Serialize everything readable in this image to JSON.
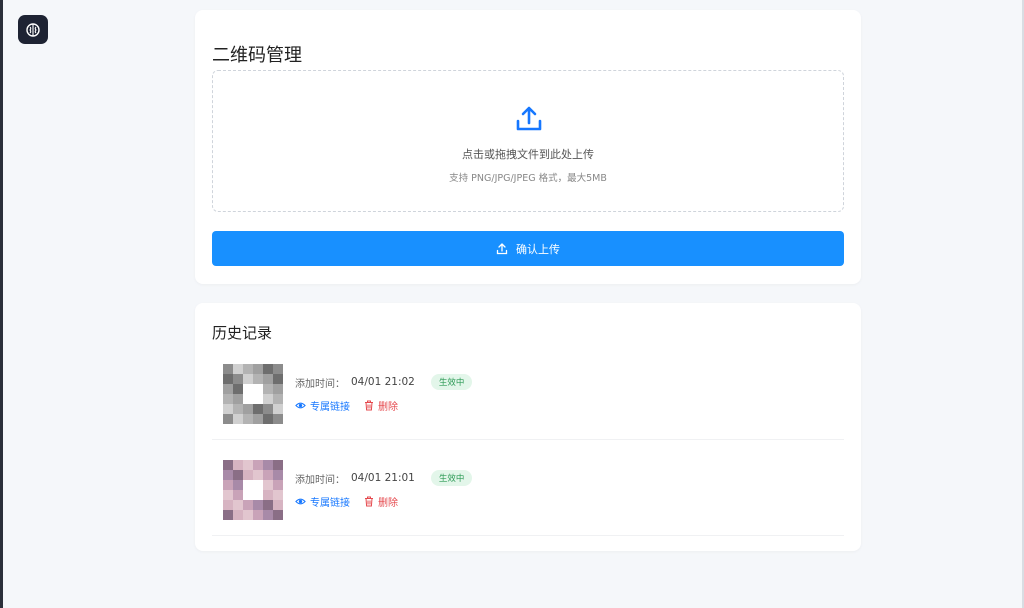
{
  "upload_card": {
    "title": "二维码管理",
    "dropzone": {
      "main_text": "点击或拖拽文件到此处上传",
      "hint_text": "支持 PNG/JPG/JPEG 格式，最大5MB"
    },
    "confirm_label": "确认上传"
  },
  "history_card": {
    "title": "历史记录",
    "items": [
      {
        "added_label": "添加时间：",
        "time": "04/01 21:02",
        "status": "生效中",
        "link_label": "专属链接",
        "delete_label": "删除",
        "thumb_palette": [
          "#8c8c8c",
          "#b3b3b3",
          "#6e6e6e",
          "#d0d0d0",
          "#a0a0a0",
          "#ffffff"
        ]
      },
      {
        "added_label": "添加时间：",
        "time": "04/01 21:01",
        "status": "生效中",
        "link_label": "专属链接",
        "delete_label": "删除",
        "thumb_palette": [
          "#c9a3b8",
          "#8a6e86",
          "#e2c6cf",
          "#a88aa8",
          "#d7b4c2",
          "#ffffff"
        ]
      }
    ]
  },
  "colors": {
    "primary": "#1890ff",
    "danger": "#e5484d",
    "success_bg": "#e3f6ea",
    "success_text": "#2e9b57"
  },
  "icons": {
    "logo": "brain-icon",
    "upload": "upload-arrow-icon",
    "link": "eye-icon",
    "delete": "trash-icon"
  }
}
